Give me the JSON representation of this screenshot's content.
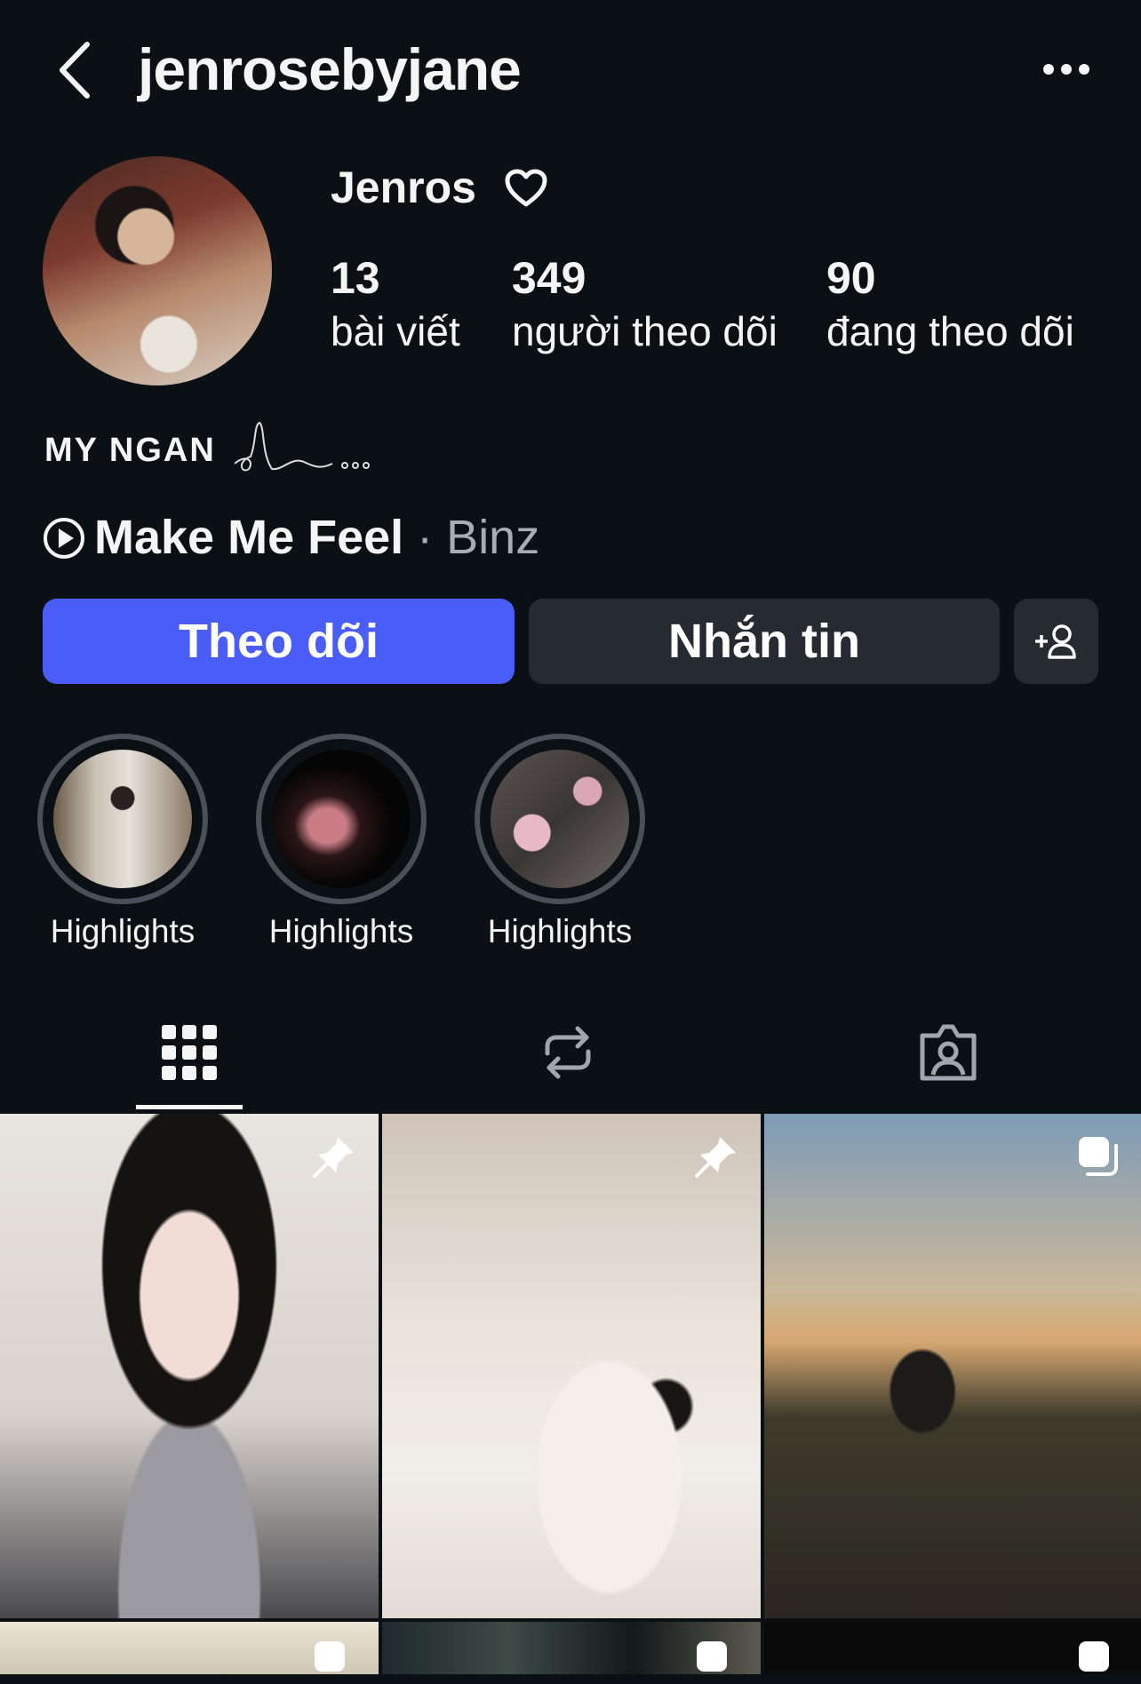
{
  "header": {
    "username": "jenrosebyjane"
  },
  "profile": {
    "display_name": "Jenros",
    "stats": [
      {
        "value": "13",
        "label": "bài viết"
      },
      {
        "value": "349",
        "label": "người theo dõi"
      },
      {
        "value": "90",
        "label": "đang theo dõi"
      }
    ],
    "bio_title": "MY NGAN",
    "music": {
      "song": "Make Me Feel",
      "separator": "·",
      "artist": "Binz"
    }
  },
  "actions": {
    "follow_label": "Theo dõi",
    "message_label": "Nhắn tin"
  },
  "highlights": [
    {
      "label": "Highlights"
    },
    {
      "label": "Highlights"
    },
    {
      "label": "Highlights"
    }
  ],
  "colors": {
    "background": "#0b1014",
    "follow_button": "#4a5df9",
    "secondary_button": "#262b31"
  },
  "icons": {
    "back": "chevron-left-icon",
    "more": "more-horizontal-icon",
    "heart": "heart-outline-icon",
    "music": "play-circle-icon",
    "add_person": "add-person-icon",
    "tab_posts": "grid-icon",
    "tab_reposts": "repost-icon",
    "tab_tagged": "tagged-person-icon",
    "pinned": "pin-icon",
    "multi": "carousel-icon"
  }
}
